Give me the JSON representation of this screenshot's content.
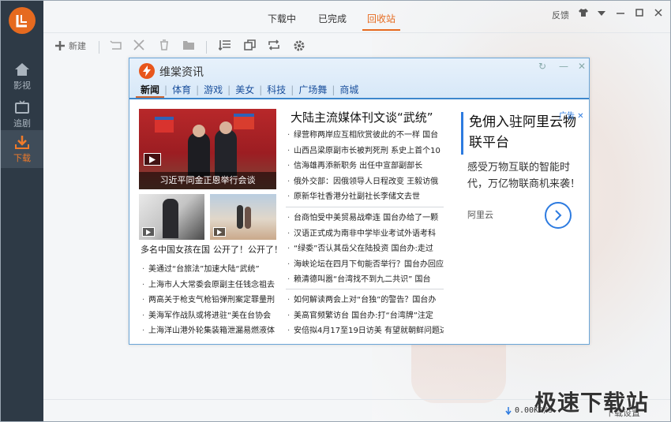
{
  "app": {
    "sidebar": [
      {
        "label": "影视",
        "icon": "home-icon"
      },
      {
        "label": "追剧",
        "icon": "tv-icon"
      },
      {
        "label": "下载",
        "icon": "download-icon"
      }
    ],
    "tabs": [
      "下载中",
      "已完成",
      "回收站"
    ],
    "active_tab": "回收站",
    "feedback": "反馈",
    "toolbar": {
      "new_label": "新建"
    },
    "status": {
      "speed": "0.00KB/s",
      "settings": "下载设置"
    },
    "watermark": "极速下载站",
    "colors": {
      "accent": "#e66a1f",
      "sidebar": "#2e3a46",
      "popup_border": "#3c87cc"
    }
  },
  "popup": {
    "title": "维棠资讯",
    "nav": [
      "新闻",
      "体育",
      "游戏",
      "美女",
      "科技",
      "广场舞",
      "商城"
    ],
    "active_nav": "新闻",
    "main_photo_caption": "习近平同金正恩举行会谈",
    "thumb1_caption": "多名中国女孩在国",
    "thumb2_caption": "公开了！公开了！",
    "headline": "大陆主流媒体刊文谈“武统”",
    "list_left": [
      "美通过“台旅法”加速大陆“武统”",
      "上海市人大常委会原副主任钱念祖去",
      "两高关于枪支气枪铅弹刑案定罪量刑",
      "美海军作战队或将进驻“美在台协会",
      "上海洋山港外轮集装箱泄漏易燃液体"
    ],
    "list_right_1": [
      "绿营称两岸应互相欣赏彼此的不一样 国台",
      "山西吕梁原副市长被判死刑 系史上首个10",
      "信海雄再添新职务 出任中宣部副部长",
      "俄外交部：因俄领导人日程改变 王毅访俄",
      "原新华社香港分社副社长李储文去世"
    ],
    "list_right_2": [
      "台商怕受中美贸易战牵连 国台办给了一颗",
      "汉语正式成为南非中学毕业考试外语考科",
      "“绿委”否认其岳父在陆投资 国台办:走过",
      "海峡论坛在四月下旬能否举行？国台办回应",
      "赖清德叫嚣“台湾找不到九二共识” 国台"
    ],
    "list_right_3": [
      "如何解读两会上对“台独”的警告？国台办",
      "美高官频繁访台 国台办:打“台湾牌”注定",
      "安倍拟4月17至19日访美 有望就朝鲜问题达"
    ],
    "ad": {
      "label": "广告",
      "title": "免佣入驻阿里云物联平台",
      "desc": "感受万物互联的智能时代，万亿物联商机来袭！",
      "brand": "阿里云"
    }
  }
}
